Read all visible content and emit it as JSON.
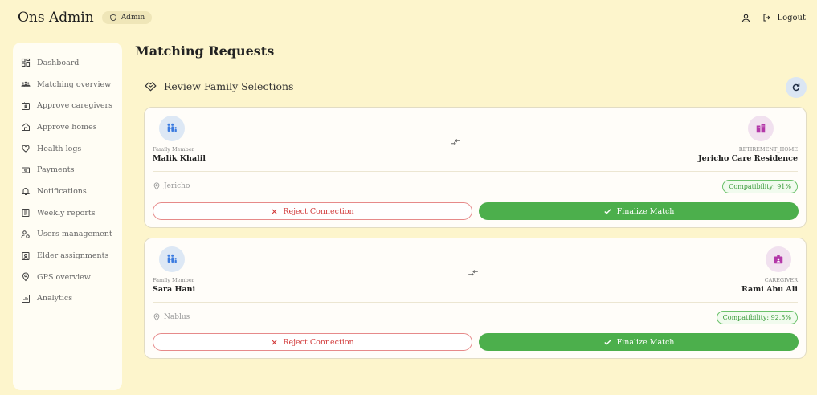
{
  "header": {
    "app_title": "Ons Admin",
    "role_badge": "Admin",
    "logout_label": "Logout"
  },
  "sidebar": {
    "items": [
      {
        "label": "Dashboard",
        "icon": "grid-icon"
      },
      {
        "label": "Matching overview",
        "icon": "users-icon"
      },
      {
        "label": "Approve caregivers",
        "icon": "id-card-icon"
      },
      {
        "label": "Approve homes",
        "icon": "home-icon"
      },
      {
        "label": "Health logs",
        "icon": "heart-icon"
      },
      {
        "label": "Payments",
        "icon": "money-icon"
      },
      {
        "label": "Notifications",
        "icon": "bell-icon"
      },
      {
        "label": "Weekly reports",
        "icon": "report-icon"
      },
      {
        "label": "Users management",
        "icon": "user-gear-icon"
      },
      {
        "label": "Elder assignments",
        "icon": "badge-icon"
      },
      {
        "label": "GPS overview",
        "icon": "pin-icon"
      },
      {
        "label": "Analytics",
        "icon": "chart-icon"
      }
    ]
  },
  "main": {
    "title": "Matching Requests",
    "section_title": "Review Family Selections",
    "reject_label": "Reject Connection",
    "finalize_label": "Finalize Match",
    "requests": [
      {
        "family_role": "Family Member",
        "family_name": "Malik Khalil",
        "target_type": "RETIREMENT_HOME",
        "target_name": "Jericho Care Residence",
        "location": "Jericho",
        "compatibility": "Compatibility: 91%"
      },
      {
        "family_role": "Family Member",
        "family_name": "Sara Hani",
        "target_type": "CAREGIVER",
        "target_name": "Rami Abu Ali",
        "location": "Nablus",
        "compatibility": "Compatibility: 92.5%"
      }
    ]
  },
  "colors": {
    "background": "#fdf5cc",
    "success": "#4caf4c",
    "danger": "#d23b3b",
    "accent_blue": "#dbe6f3"
  }
}
